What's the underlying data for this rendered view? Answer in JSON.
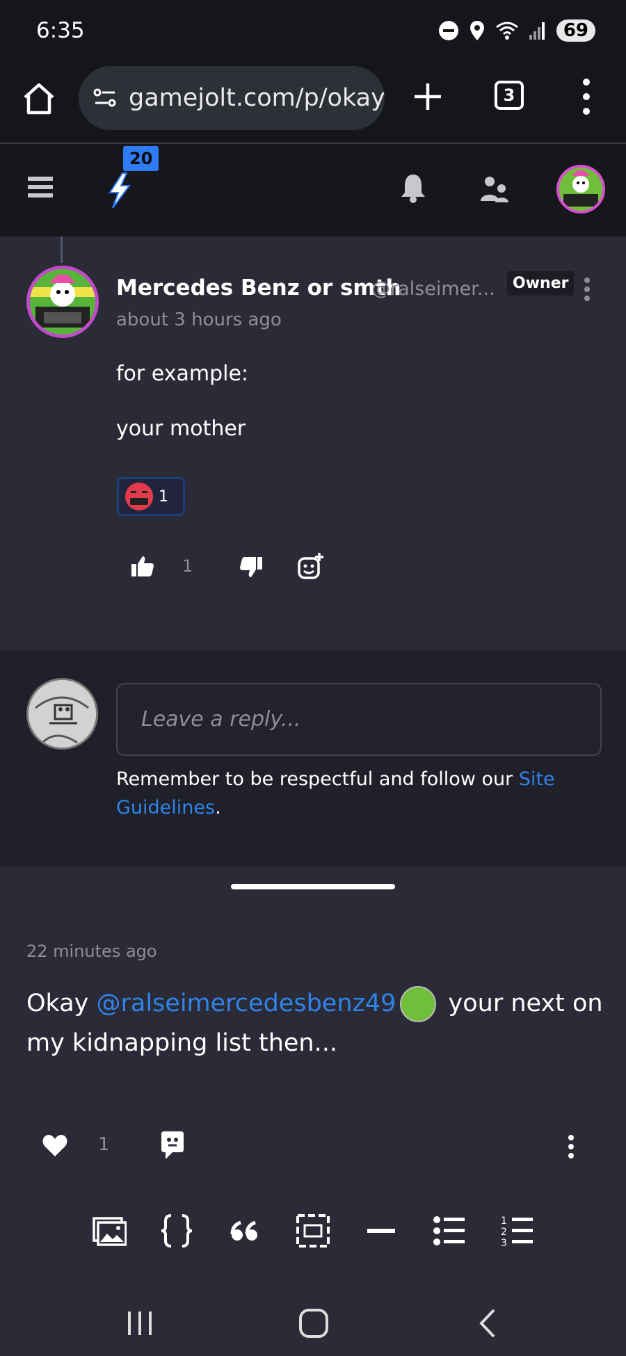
{
  "status_bar": {
    "time": "6:35",
    "battery": "69"
  },
  "browser": {
    "url": "gamejolt.com/p/okay",
    "tab_count": "3"
  },
  "header": {
    "notification_badge": "20"
  },
  "comment": {
    "author_name": "Mercedes Benz or smth",
    "author_handle": "@ralseimer...",
    "owner_label": "Owner",
    "time_ago": "about 3 hours ago",
    "paragraphs": [
      "for example:",
      "your mother"
    ],
    "reaction_count": "1",
    "like_count": "1"
  },
  "reply": {
    "placeholder": "Leave a reply...",
    "notice_prefix": "Remember to be respectful and follow our ",
    "notice_link": "Site Guidelines",
    "notice_suffix": "."
  },
  "post": {
    "time_ago": "22 minutes ago",
    "text_prefix": "Okay ",
    "mention": "@ralseimercedesbenz49",
    "text_suffix": " your next on my kidnapping list then...",
    "like_count": "1"
  },
  "toolbar_icons": [
    "image-icon",
    "code-icon",
    "quote-icon",
    "spoiler-icon",
    "divider-icon",
    "bullet-list-icon",
    "numbered-list-icon"
  ],
  "colors": {
    "accent_blue": "#2f84ea",
    "badge_blue": "#2f7bf6",
    "background": "#2a2b36"
  }
}
